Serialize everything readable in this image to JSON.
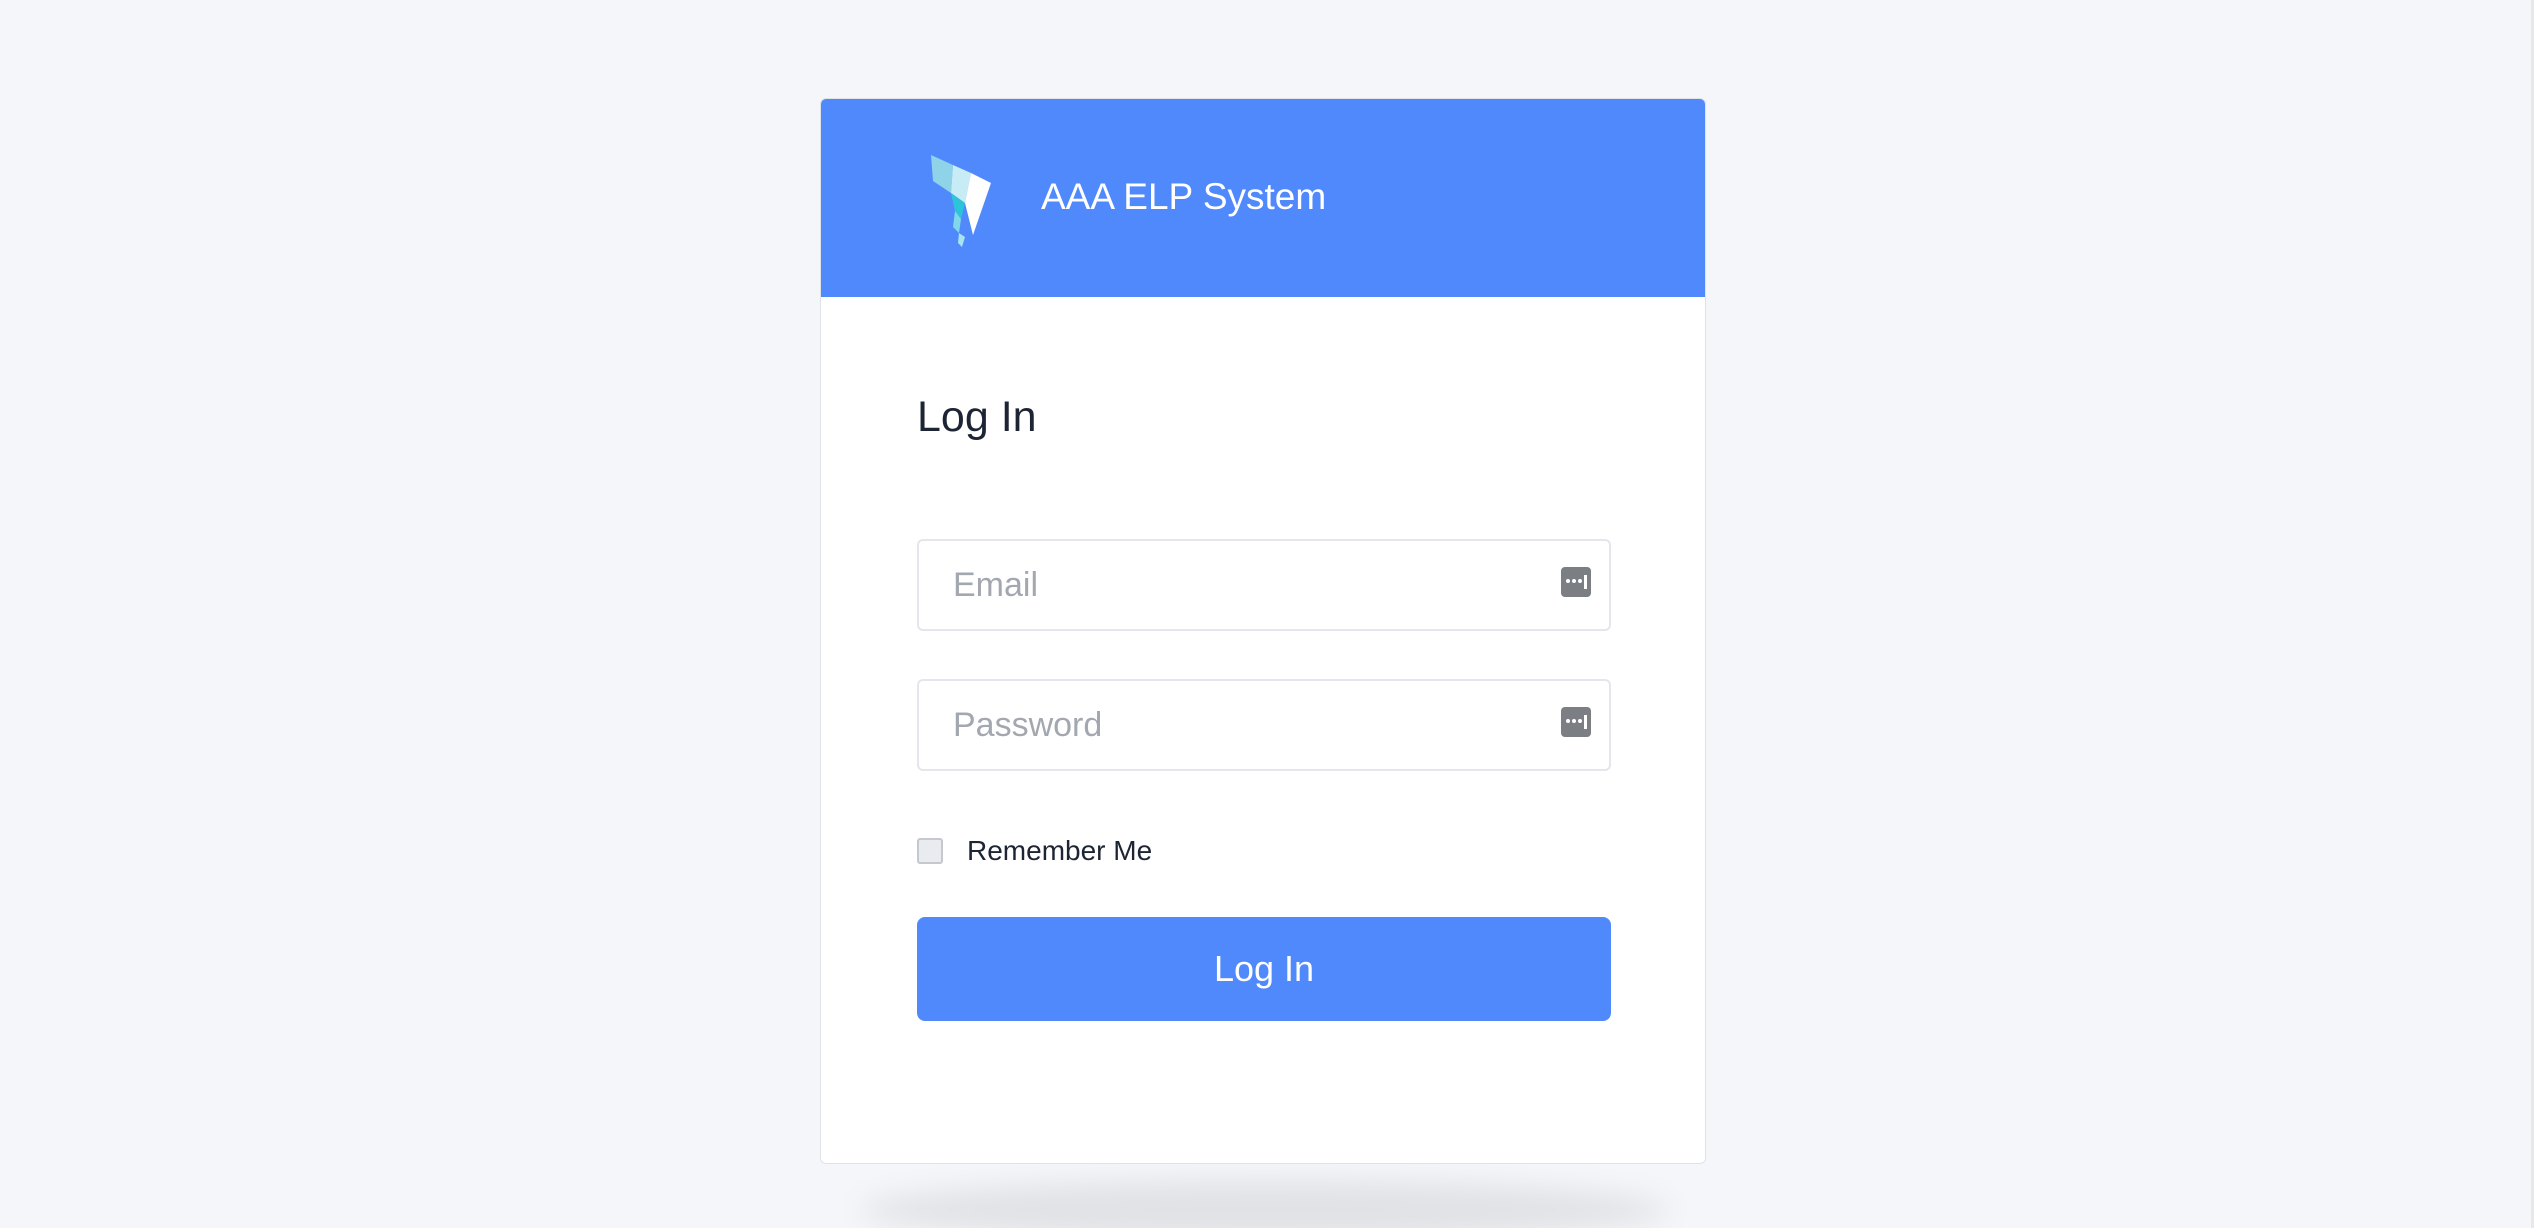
{
  "app": {
    "title": "AAA ELP System",
    "logo_icon": "brand-logo-icon"
  },
  "login": {
    "heading": "Log In",
    "email": {
      "placeholder": "Email",
      "value": "",
      "icon": "password-manager-key-icon"
    },
    "password": {
      "placeholder": "Password",
      "value": "",
      "icon": "password-manager-key-icon"
    },
    "remember_me": {
      "label": "Remember Me",
      "checked": false
    },
    "submit_label": "Log In"
  },
  "colors": {
    "brand": "#5089fb",
    "background": "#f4f6f9",
    "text": "#1d2433",
    "placeholder": "#a3a8b0"
  }
}
